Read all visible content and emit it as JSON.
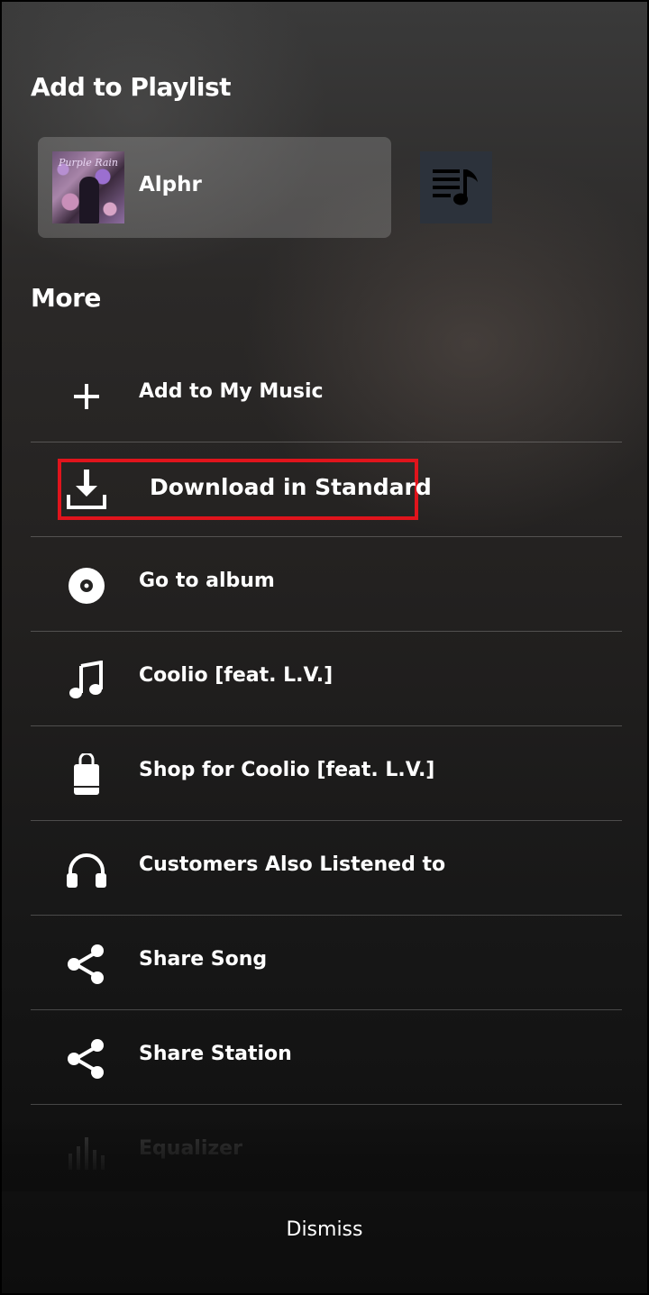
{
  "add_to_playlist": {
    "title": "Add to Playlist",
    "playlist_name": "Alphr",
    "album_art_text": "Purple Rain",
    "new_playlist_icon": "playlist-music-icon"
  },
  "more": {
    "title": "More",
    "items": [
      {
        "label": "Add to My Music",
        "icon": "plus-icon"
      },
      {
        "label": "Download in Standard",
        "icon": "download-icon"
      },
      {
        "label": "Go to album",
        "icon": "album-disc-icon"
      },
      {
        "label": "Coolio [feat. L.V.]",
        "icon": "music-note-icon"
      },
      {
        "label": "Shop for Coolio [feat. L.V.]",
        "icon": "shopping-bag-icon"
      },
      {
        "label": "Customers Also Listened to",
        "icon": "headphones-icon"
      },
      {
        "label": "Share Song",
        "icon": "share-icon"
      },
      {
        "label": "Share Station",
        "icon": "share-icon"
      },
      {
        "label": "Equalizer",
        "icon": "equalizer-icon"
      }
    ]
  },
  "dismiss_label": "Dismiss",
  "colors": {
    "highlight": "#e0141c",
    "card": "#5a5a5a",
    "new_playlist_button": "#2c323b"
  }
}
